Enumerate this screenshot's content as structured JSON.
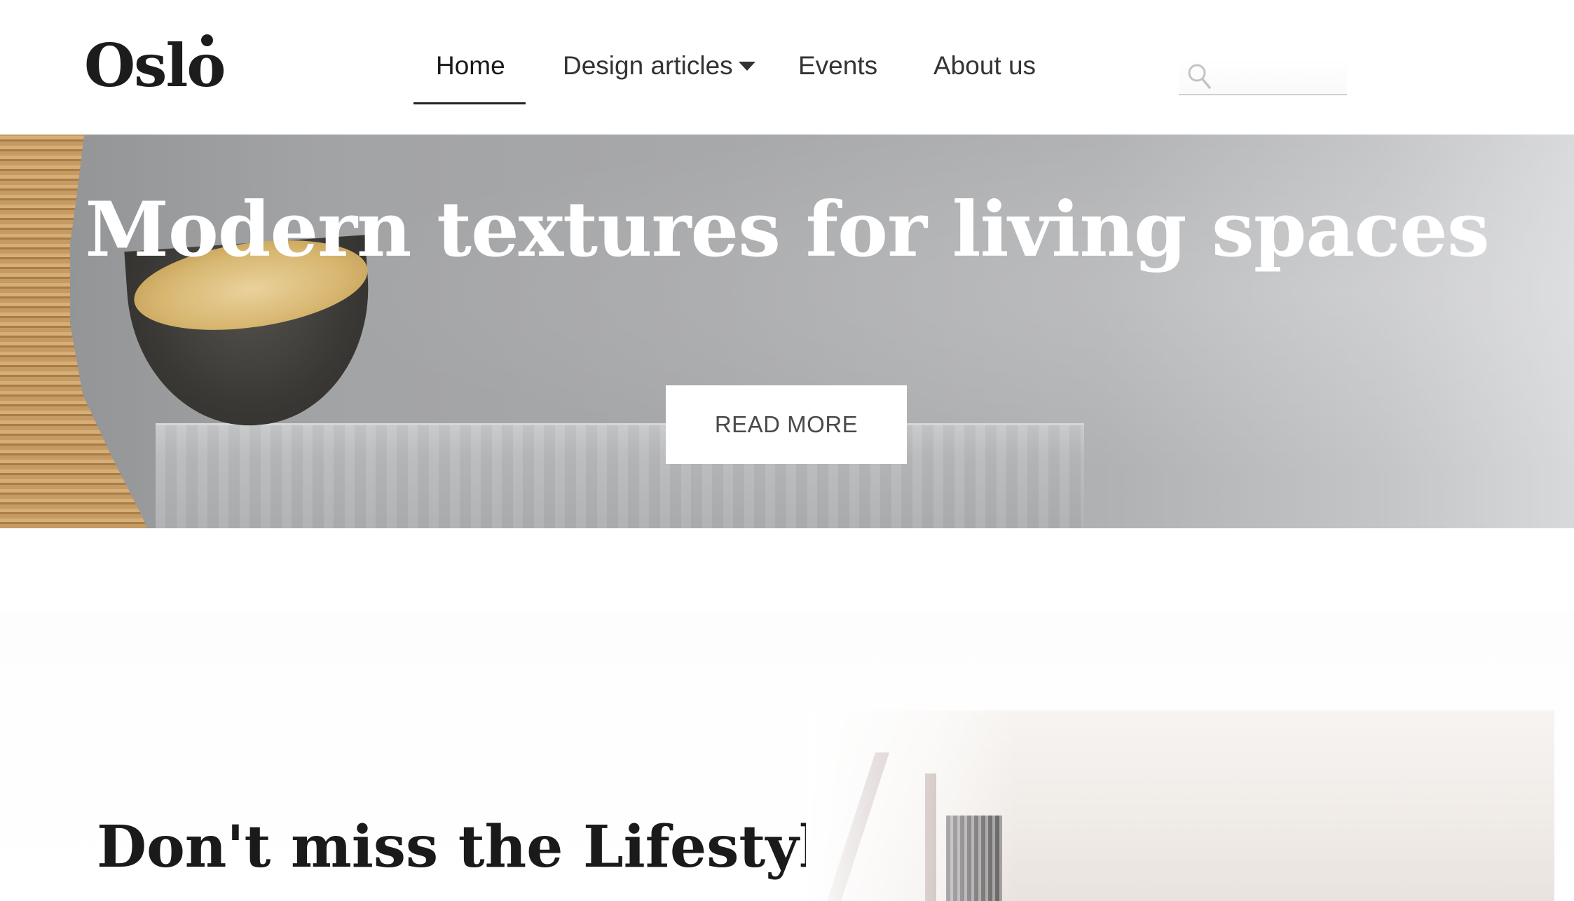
{
  "header": {
    "logo": "Oslo",
    "nav": [
      {
        "label": "Home",
        "active": true
      },
      {
        "label": "Design articles",
        "has_dropdown": true
      },
      {
        "label": "Events"
      },
      {
        "label": "About us"
      }
    ],
    "search": {
      "placeholder": "",
      "value": "",
      "icon": "search-icon"
    }
  },
  "hero": {
    "title": "Modern textures for living spaces",
    "button_label": "READ MORE"
  },
  "section": {
    "title": "Don't miss the Lifestyle"
  },
  "colors": {
    "text_dark": "#1a1a1a",
    "nav_text": "#333333",
    "button_bg": "#ffffff",
    "hero_text": "#ffffff"
  }
}
